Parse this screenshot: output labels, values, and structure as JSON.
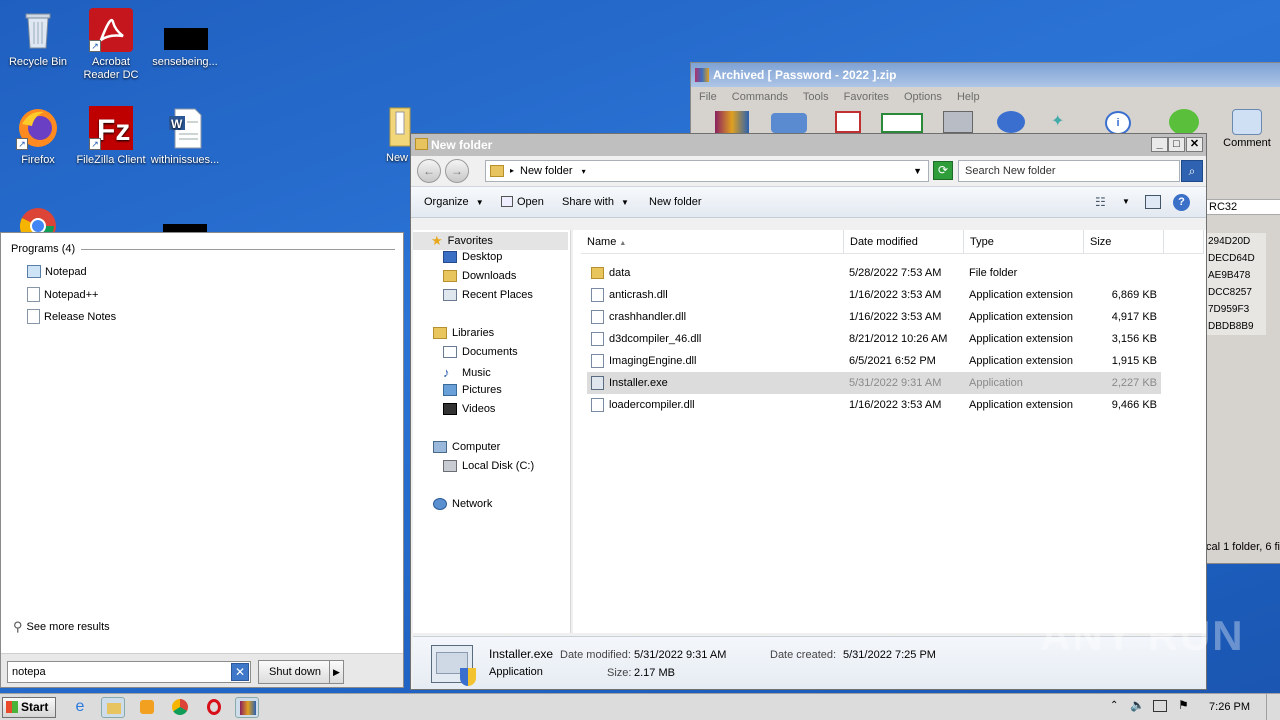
{
  "desktop": {
    "icons": [
      {
        "label": "Recycle Bin"
      },
      {
        "label": "Acrobat\nReader DC"
      },
      {
        "label": "sensebeing..."
      },
      {
        "label": "Firefox"
      },
      {
        "label": "FileZilla Client"
      },
      {
        "label": "withinissues..."
      },
      {
        "label": "New"
      }
    ]
  },
  "winrar": {
    "title": "Archived [ Password - 2022 ].zip",
    "menu": [
      "File",
      "Commands",
      "Tools",
      "Favorites",
      "Options",
      "Help"
    ],
    "comment_label": "Comment",
    "crc_header": "RC32",
    "crc_values": [
      "294D20D",
      "DECD64D",
      "AE9B478",
      "DCC8257",
      "7D959F3",
      "DBDB8B9"
    ],
    "status": "cal 1 folder, 6 fi"
  },
  "explorer": {
    "title": "New folder",
    "address": "New folder",
    "search_placeholder": "Search New folder",
    "commands": {
      "organize": "Organize",
      "open": "Open",
      "share_with": "Share with",
      "new_folder": "New folder"
    },
    "nav": {
      "favorites": "Favorites",
      "desktop": "Desktop",
      "downloads": "Downloads",
      "recent": "Recent Places",
      "libraries": "Libraries",
      "documents": "Documents",
      "music": "Music",
      "pictures": "Pictures",
      "videos": "Videos",
      "computer": "Computer",
      "local_disk": "Local Disk (C:)",
      "network": "Network"
    },
    "columns": {
      "name": "Name",
      "date": "Date modified",
      "type": "Type",
      "size": "Size"
    },
    "files": [
      {
        "name": "data",
        "date": "5/28/2022 7:53 AM",
        "type": "File folder",
        "size": ""
      },
      {
        "name": "anticrash.dll",
        "date": "1/16/2022 3:53 AM",
        "type": "Application extension",
        "size": "6,869 KB"
      },
      {
        "name": "crashhandler.dll",
        "date": "1/16/2022 3:53 AM",
        "type": "Application extension",
        "size": "4,917 KB"
      },
      {
        "name": "d3dcompiler_46.dll",
        "date": "8/21/2012 10:26 AM",
        "type": "Application extension",
        "size": "3,156 KB"
      },
      {
        "name": "ImagingEngine.dll",
        "date": "6/5/2021 6:52 PM",
        "type": "Application extension",
        "size": "1,915 KB"
      },
      {
        "name": "Installer.exe",
        "date": "5/31/2022 9:31 AM",
        "type": "Application",
        "size": "2,227 KB"
      },
      {
        "name": "loadercompiler.dll",
        "date": "1/16/2022 3:53 AM",
        "type": "Application extension",
        "size": "9,466 KB"
      }
    ],
    "details": {
      "name": "Installer.exe",
      "type": "Application",
      "modified_label": "Date modified:",
      "modified": "5/31/2022 9:31 AM",
      "size_label": "Size:",
      "size": "2.17 MB",
      "created_label": "Date created:",
      "created": "5/31/2022 7:25 PM"
    }
  },
  "startmenu": {
    "programs_header": "Programs (4)",
    "programs": [
      "Notepad",
      "Notepad++",
      "Release Notes"
    ],
    "see_more": "See more results",
    "search_value": "notepa",
    "shutdown": "Shut down"
  },
  "taskbar": {
    "start": "Start",
    "clock": "7:26 PM"
  },
  "watermark": "ANY RUN"
}
